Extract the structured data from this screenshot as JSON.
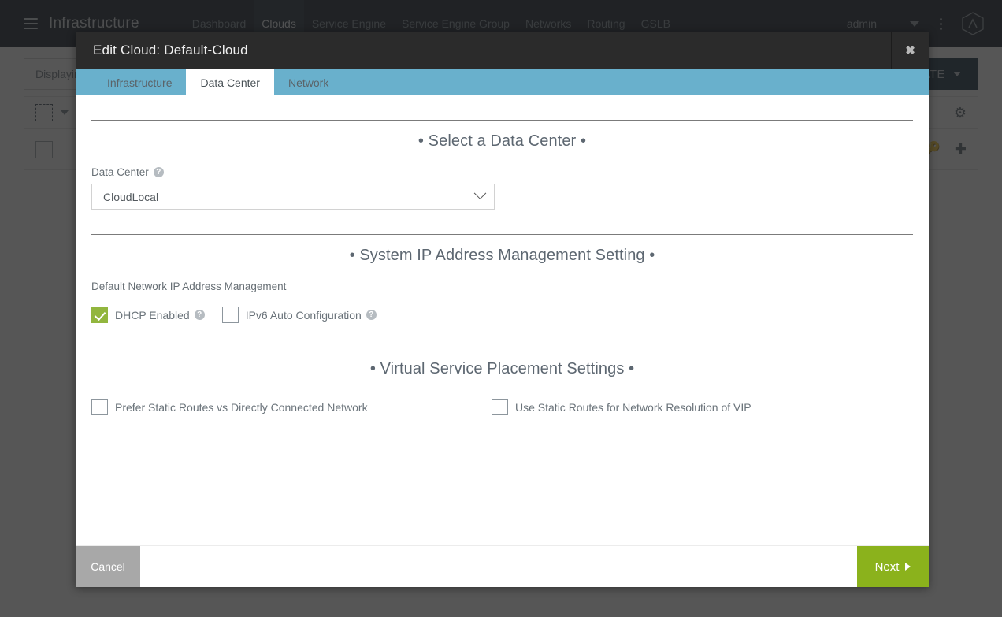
{
  "topbar": {
    "menu_icon": "hamburger-icon",
    "app_title": "Infrastructure",
    "nav_items": [
      {
        "label": "Dashboard",
        "active": false
      },
      {
        "label": "Clouds",
        "active": true
      },
      {
        "label": "Service Engine",
        "active": false
      },
      {
        "label": "Service Engine Group",
        "active": false
      },
      {
        "label": "Networks",
        "active": false
      },
      {
        "label": "Routing",
        "active": false
      },
      {
        "label": "GSLB",
        "active": false
      }
    ],
    "user": "admin",
    "caret_icon": "chevron-down-icon",
    "kebab_icon": "kebab-menu-icon",
    "avatar_icon": "avatar-icon"
  },
  "background_page": {
    "display_text": "Displaying",
    "create_button": "ATE",
    "gear_icon": "gear-icon",
    "key_icon": "key-icon",
    "plus_icon": "plus-icon"
  },
  "modal": {
    "title": "Edit Cloud: Default-Cloud",
    "close_label": "✖",
    "tabs": [
      {
        "label": "Infrastructure",
        "active": false
      },
      {
        "label": "Data Center",
        "active": true
      },
      {
        "label": "Network",
        "active": false
      }
    ],
    "sections": {
      "data_center": {
        "heading": "• Select a Data Center •",
        "field_label": "Data Center",
        "help_icon": "?",
        "selected_value": "CloudLocal",
        "chevron_icon": "chevron-down-icon"
      },
      "ip_management": {
        "heading": "• System IP Address Management Setting •",
        "sub_label": "Default Network IP Address Management",
        "checkboxes": [
          {
            "label": "DHCP Enabled",
            "checked": true,
            "help": "?"
          },
          {
            "label": "IPv6 Auto Configuration",
            "checked": false,
            "help": "?"
          }
        ]
      },
      "placement": {
        "heading": "• Virtual Service Placement Settings •",
        "checkboxes": [
          {
            "label": "Prefer Static Routes vs Directly Connected Network",
            "checked": false
          },
          {
            "label": "Use Static Routes for Network Resolution of VIP",
            "checked": false
          }
        ]
      }
    },
    "footer": {
      "cancel_label": "Cancel",
      "next_label": "Next",
      "next_arrow_icon": "arrow-right-icon"
    }
  },
  "colors": {
    "topbar_bg": "#0a1620",
    "tabbar_blue": "#69b0cc",
    "modal_header_bg": "#2b2b2b",
    "checkbox_green": "#92b63e",
    "next_green": "#8bb21c",
    "cancel_gray": "#a8a8a8",
    "create_navy": "#0b2537"
  }
}
